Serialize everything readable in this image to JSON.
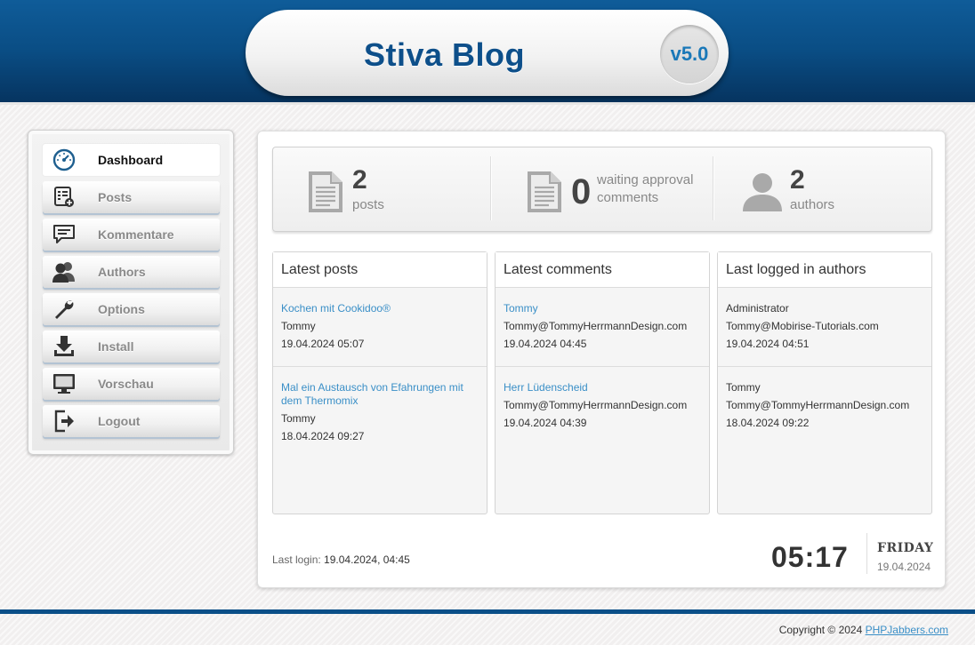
{
  "header": {
    "title": "Stiva Blog",
    "version": "v5.0"
  },
  "sidebar": {
    "items": [
      {
        "label": "Dashboard",
        "icon": "dashboard-gauge-icon",
        "active": true
      },
      {
        "label": "Posts",
        "icon": "posts-list-icon",
        "active": false
      },
      {
        "label": "Kommentare",
        "icon": "comment-bubble-icon",
        "active": false
      },
      {
        "label": "Authors",
        "icon": "users-icon",
        "active": false
      },
      {
        "label": "Options",
        "icon": "wrench-icon",
        "active": false
      },
      {
        "label": "Install",
        "icon": "download-icon",
        "active": false
      },
      {
        "label": "Vorschau",
        "icon": "monitor-icon",
        "active": false
      },
      {
        "label": "Logout",
        "icon": "logout-icon",
        "active": false
      }
    ]
  },
  "stats": {
    "posts": {
      "count": "2",
      "label": "posts"
    },
    "comments": {
      "count": "0",
      "label_line1": "waiting approval",
      "label_line2": "comments"
    },
    "authors": {
      "count": "2",
      "label": "authors"
    }
  },
  "latest_posts": {
    "title": "Latest posts",
    "items": [
      {
        "title": "Kochen mit Cookidoo®",
        "author": "Tommy",
        "date": "19.04.2024 05:07"
      },
      {
        "title": "Mal ein Austausch von Efahrungen mit dem Thermomix",
        "author": "Tommy",
        "date": "18.04.2024 09:27"
      }
    ]
  },
  "latest_comments": {
    "title": "Latest comments",
    "items": [
      {
        "name": "Tommy",
        "email": "Tommy@TommyHerrmannDesign.com",
        "date": "19.04.2024 04:45"
      },
      {
        "name": "Herr Lüdenscheid",
        "email": "Tommy@TommyHerrmannDesign.com",
        "date": "19.04.2024 04:39"
      }
    ]
  },
  "last_authors": {
    "title": "Last logged in authors",
    "items": [
      {
        "name": "Administrator",
        "email": "Tommy@Mobirise-Tutorials.com",
        "date": "19.04.2024 04:51"
      },
      {
        "name": "Tommy",
        "email": "Tommy@TommyHerrmannDesign.com",
        "date": "18.04.2024 09:22"
      }
    ]
  },
  "last_login": {
    "label": "Last login:",
    "value": "19.04.2024, 04:45"
  },
  "clock": {
    "time": "05:17",
    "day": "FRIDAY",
    "date": "19.04.2024"
  },
  "footer": {
    "copyright": "Copyright © 2024",
    "link_text": "PHPJabbers.com"
  },
  "colors": {
    "header_blue": "#0a4d84",
    "link": "#3a8fc7",
    "version": "#1a78b8"
  }
}
